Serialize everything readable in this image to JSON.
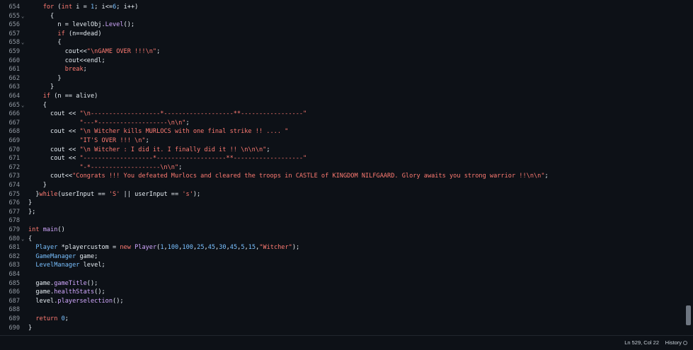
{
  "editor": {
    "lines": [
      {
        "n": "654",
        "fold": "",
        "tokens": [
          [
            "    ",
            "pl"
          ],
          [
            "for",
            "kw"
          ],
          [
            " (",
            "pl"
          ],
          [
            "int",
            "kw"
          ],
          [
            " i = ",
            "pl"
          ],
          [
            "1",
            "nu"
          ],
          [
            "; i<=",
            "pl"
          ],
          [
            "6",
            "nu"
          ],
          [
            "; i++)",
            "pl"
          ]
        ]
      },
      {
        "n": "655",
        "fold": "⌄",
        "tokens": [
          [
            "      {",
            "pl"
          ]
        ]
      },
      {
        "n": "656",
        "fold": "",
        "tokens": [
          [
            "        n = levelObj.",
            "pl"
          ],
          [
            "Level",
            "fn"
          ],
          [
            "();",
            "pl"
          ]
        ]
      },
      {
        "n": "657",
        "fold": "",
        "tokens": [
          [
            "        ",
            "pl"
          ],
          [
            "if",
            "kw"
          ],
          [
            " (n==dead)",
            "pl"
          ]
        ]
      },
      {
        "n": "658",
        "fold": "⌄",
        "tokens": [
          [
            "        {",
            "pl"
          ]
        ]
      },
      {
        "n": "659",
        "fold": "",
        "tokens": [
          [
            "          cout<<",
            "pl"
          ],
          [
            "\"\\nGAME OVER !!!\\n\"",
            "st"
          ],
          [
            ";",
            "pl"
          ]
        ]
      },
      {
        "n": "660",
        "fold": "",
        "tokens": [
          [
            "          cout<<endl;",
            "pl"
          ]
        ]
      },
      {
        "n": "661",
        "fold": "",
        "tokens": [
          [
            "          ",
            "pl"
          ],
          [
            "break",
            "kw"
          ],
          [
            ";",
            "pl"
          ]
        ]
      },
      {
        "n": "662",
        "fold": "",
        "tokens": [
          [
            "        }",
            "pl"
          ]
        ]
      },
      {
        "n": "663",
        "fold": "",
        "tokens": [
          [
            "      }",
            "pl"
          ]
        ]
      },
      {
        "n": "664",
        "fold": "",
        "tokens": [
          [
            "    ",
            "pl"
          ],
          [
            "if",
            "kw"
          ],
          [
            " (n == alive)",
            "pl"
          ]
        ]
      },
      {
        "n": "665",
        "fold": "⌄",
        "tokens": [
          [
            "    {",
            "pl"
          ]
        ]
      },
      {
        "n": "666",
        "fold": "",
        "tokens": [
          [
            "      cout << ",
            "pl"
          ],
          [
            "\"\\n-------------------*-------------------**-----------------\"",
            "st"
          ]
        ]
      },
      {
        "n": "667",
        "fold": "",
        "tokens": [
          [
            "              ",
            "pl"
          ],
          [
            "\"---*-------------------\\n\\n\"",
            "st"
          ],
          [
            ";",
            "pl"
          ]
        ]
      },
      {
        "n": "668",
        "fold": "",
        "tokens": [
          [
            "      cout << ",
            "pl"
          ],
          [
            "\"\\n Witcher kills MURLOCS with one final strike !! .... \"",
            "st"
          ]
        ]
      },
      {
        "n": "669",
        "fold": "",
        "tokens": [
          [
            "              ",
            "pl"
          ],
          [
            "\"IT'S OVER !!! \\n\"",
            "st"
          ],
          [
            ";",
            "pl"
          ]
        ]
      },
      {
        "n": "670",
        "fold": "",
        "tokens": [
          [
            "      cout << ",
            "pl"
          ],
          [
            "\"\\n Witcher : I did it. I finally did it !! \\n\\n\\n\"",
            "st"
          ],
          [
            ";",
            "pl"
          ]
        ]
      },
      {
        "n": "671",
        "fold": "",
        "tokens": [
          [
            "      cout << ",
            "pl"
          ],
          [
            "\"-------------------*-------------------**-------------------\"",
            "st"
          ]
        ]
      },
      {
        "n": "672",
        "fold": "",
        "tokens": [
          [
            "              ",
            "pl"
          ],
          [
            "\"-*-------------------\\n\\n\"",
            "st"
          ],
          [
            ";",
            "pl"
          ]
        ]
      },
      {
        "n": "673",
        "fold": "",
        "tokens": [
          [
            "      cout<<",
            "pl"
          ],
          [
            "\"Congrats !!! You defeated Murlocs and cleared the troops in CASTLE of KINGDOM NILFGAARD. Glory awaits you strong warrior !!\\n\\n\"",
            "st"
          ],
          [
            ";",
            "pl"
          ]
        ]
      },
      {
        "n": "674",
        "fold": "",
        "tokens": [
          [
            "    }",
            "pl"
          ]
        ]
      },
      {
        "n": "675",
        "fold": "",
        "tokens": [
          [
            "  }",
            "pl"
          ],
          [
            "while",
            "kw"
          ],
          [
            "(userInput == ",
            "pl"
          ],
          [
            "'S'",
            "st"
          ],
          [
            " || userInput == ",
            "pl"
          ],
          [
            "'s'",
            "st"
          ],
          [
            ");",
            "pl"
          ]
        ]
      },
      {
        "n": "676",
        "fold": "",
        "tokens": [
          [
            "}",
            "pl"
          ]
        ]
      },
      {
        "n": "677",
        "fold": "",
        "tokens": [
          [
            "};",
            "pl"
          ]
        ]
      },
      {
        "n": "678",
        "fold": "",
        "tokens": []
      },
      {
        "n": "679",
        "fold": "",
        "tokens": [
          [
            "int",
            "kw"
          ],
          [
            " ",
            "pl"
          ],
          [
            "main",
            "fn"
          ],
          [
            "()",
            "pl"
          ]
        ]
      },
      {
        "n": "680",
        "fold": "⌄",
        "tokens": [
          [
            "{",
            "pl"
          ]
        ]
      },
      {
        "n": "681",
        "fold": "",
        "tokens": [
          [
            "  ",
            "pl"
          ],
          [
            "Player",
            "ty"
          ],
          [
            " *playercustom = ",
            "pl"
          ],
          [
            "new",
            "kw"
          ],
          [
            " ",
            "pl"
          ],
          [
            "Player",
            "fn"
          ],
          [
            "(",
            "pl"
          ],
          [
            "1",
            "nu"
          ],
          [
            ",",
            "pl"
          ],
          [
            "100",
            "nu"
          ],
          [
            ",",
            "pl"
          ],
          [
            "100",
            "nu"
          ],
          [
            ",",
            "pl"
          ],
          [
            "25",
            "nu"
          ],
          [
            ",",
            "pl"
          ],
          [
            "45",
            "nu"
          ],
          [
            ",",
            "pl"
          ],
          [
            "30",
            "nu"
          ],
          [
            ",",
            "pl"
          ],
          [
            "45",
            "nu"
          ],
          [
            ",",
            "pl"
          ],
          [
            "5",
            "nu"
          ],
          [
            ",",
            "pl"
          ],
          [
            "15",
            "nu"
          ],
          [
            ",",
            "pl"
          ],
          [
            "\"Witcher\"",
            "st"
          ],
          [
            ");",
            "pl"
          ]
        ]
      },
      {
        "n": "682",
        "fold": "",
        "tokens": [
          [
            "  ",
            "pl"
          ],
          [
            "GameManager",
            "ty"
          ],
          [
            " game;",
            "pl"
          ]
        ]
      },
      {
        "n": "683",
        "fold": "",
        "tokens": [
          [
            "  ",
            "pl"
          ],
          [
            "LevelManager",
            "ty"
          ],
          [
            " level;",
            "pl"
          ]
        ]
      },
      {
        "n": "684",
        "fold": "",
        "tokens": []
      },
      {
        "n": "685",
        "fold": "",
        "tokens": [
          [
            "  game.",
            "pl"
          ],
          [
            "gameTitle",
            "fn"
          ],
          [
            "();",
            "pl"
          ]
        ]
      },
      {
        "n": "686",
        "fold": "",
        "tokens": [
          [
            "  game.",
            "pl"
          ],
          [
            "healthStats",
            "fn"
          ],
          [
            "();",
            "pl"
          ]
        ]
      },
      {
        "n": "687",
        "fold": "",
        "tokens": [
          [
            "  level.",
            "pl"
          ],
          [
            "playerselection",
            "fn"
          ],
          [
            "();",
            "pl"
          ]
        ]
      },
      {
        "n": "688",
        "fold": "",
        "tokens": []
      },
      {
        "n": "689",
        "fold": "",
        "tokens": [
          [
            "  ",
            "pl"
          ],
          [
            "return",
            "kw"
          ],
          [
            " ",
            "pl"
          ],
          [
            "0",
            "nu"
          ],
          [
            ";",
            "pl"
          ]
        ]
      },
      {
        "n": "690",
        "fold": "",
        "tokens": [
          [
            "}",
            "pl"
          ]
        ]
      }
    ]
  },
  "status": {
    "position": "Ln 529, Col 22",
    "history_label": "History"
  },
  "icons": {
    "fold": "chevron-down-icon",
    "history": "history-icon"
  },
  "colors": {
    "background": "#0d1117",
    "keyword": "#ff7b72",
    "string": "#ff7b72",
    "type": "#79c0ff",
    "function": "#d2a8ff",
    "number": "#79c0ff",
    "text": "#e6edf3",
    "line_number": "#9198a1"
  }
}
